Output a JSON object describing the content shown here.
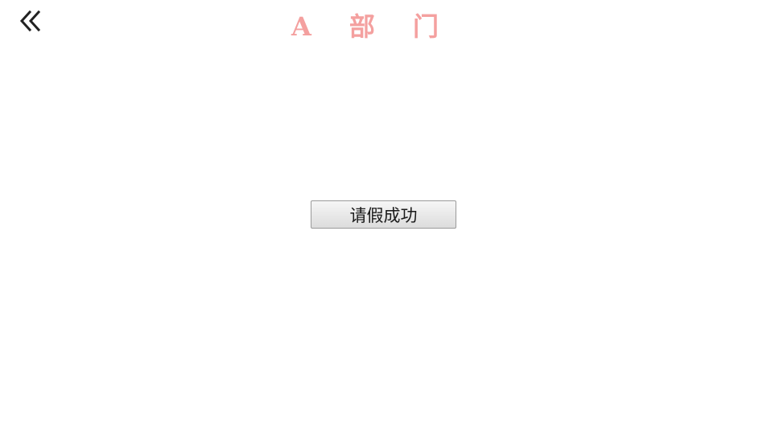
{
  "header": {
    "back_icon": "double-chevron-left-icon",
    "title": "A 部 门",
    "title_color": "#f4a09f"
  },
  "main": {
    "status_button_label": "请假成功"
  }
}
